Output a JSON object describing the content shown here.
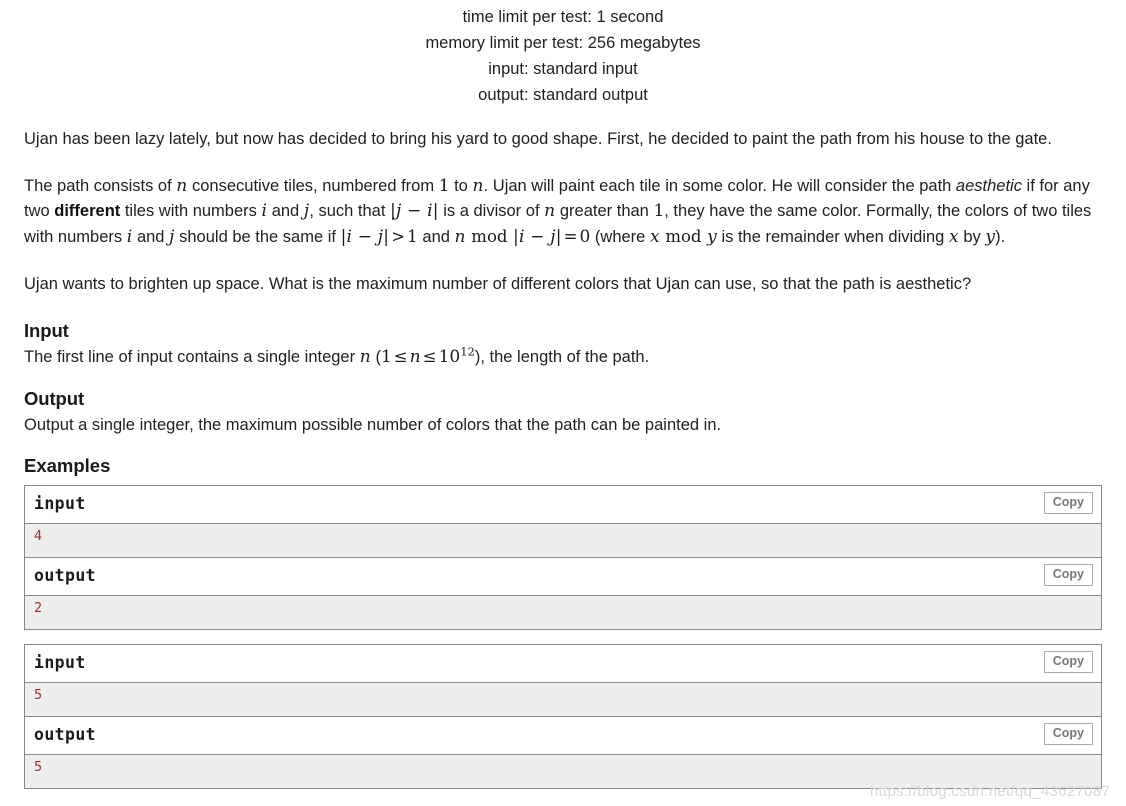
{
  "limits": {
    "time": "time limit per test: 1 second",
    "memory": "memory limit per test: 256 megabytes",
    "input": "input: standard input",
    "output": "output: standard output"
  },
  "statement": {
    "para1": "Ujan has been lazy lately, but now has decided to bring his yard to good shape. First, he decided to paint the path from his house to the gate.",
    "para2": {
      "t1": "The path consists of ",
      "m_n1": "n",
      "t2": " consecutive tiles, numbered from ",
      "m_1": "1",
      "t3": " to ",
      "m_n2": "n",
      "t4": ". Ujan will paint each tile in some color. He will consider the path ",
      "em_aesthetic": "aesthetic",
      "t5": " if for any two ",
      "b_different": "different",
      "t6": " tiles with numbers ",
      "m_i": "i",
      "t7": " and ",
      "m_j": "j",
      "t8": ", such that ",
      "m_absji": "|j − i|",
      "t9": " is a divisor of ",
      "m_n3": "n",
      "t10": " greater than ",
      "m_1b": "1",
      "t11": ", they have the same color. Formally, the colors of two tiles with numbers ",
      "m_i2": "i",
      "t12": " and ",
      "m_j2": "j",
      "t13": " should be the same if ",
      "m_absij": "|i − j|",
      "m_gt": ">",
      "m_1c": "1",
      "t14": " and ",
      "m_n4": "n",
      "m_mod": "mod",
      "m_absij2": "|i − j|",
      "m_eq": "=",
      "m_0": "0",
      "t15": " (where ",
      "m_x": "x",
      "m_mod2": "mod",
      "m_y": "y",
      "t16": " is the remainder when dividing ",
      "m_x2": "x",
      "t17": " by ",
      "m_y2": "y",
      "t18": ")."
    },
    "para3": "Ujan wants to brighten up space. What is the maximum number of different colors that Ujan can use, so that the path is aesthetic?"
  },
  "input_section": {
    "heading": "Input",
    "t1": "The first line of input contains a single integer ",
    "m_n": "n",
    "t2": " (",
    "m_1": "1",
    "m_le1": "≤",
    "m_n2": "n",
    "m_le2": "≤",
    "m_10": "10",
    "m_exp": "12",
    "t3": "), the length of the path."
  },
  "output_section": {
    "heading": "Output",
    "text": "Output a single integer, the maximum possible number of colors that the path can be painted in."
  },
  "examples": {
    "heading": "Examples",
    "copy_label": "Copy",
    "tests": [
      {
        "input_label": "input",
        "input_value": "4",
        "output_label": "output",
        "output_value": "2"
      },
      {
        "input_label": "input",
        "input_value": "5",
        "output_label": "output",
        "output_value": "5"
      }
    ]
  },
  "watermark": "https://blog.csdn.net/qq_43627087"
}
